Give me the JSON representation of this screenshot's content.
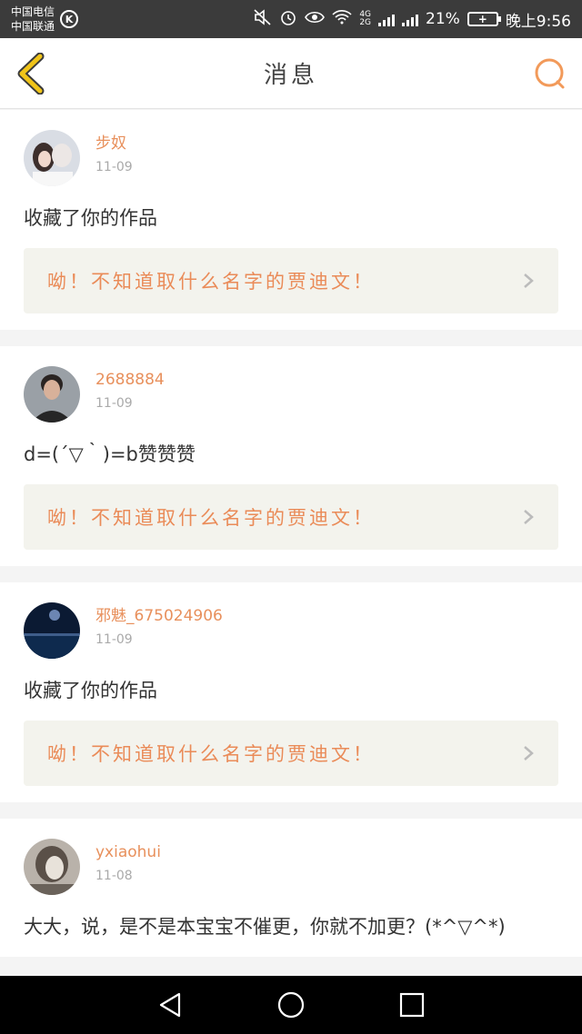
{
  "status": {
    "carrier1": "中国电信",
    "carrier2": "中国联通",
    "badge": "K",
    "net1": "4G",
    "net2": "2G",
    "battery_pct": "21%",
    "time": "晚上9:56"
  },
  "header": {
    "title": "消息"
  },
  "messages": [
    {
      "username": "步奴",
      "date": "11-09",
      "text": "收藏了你的作品",
      "work": "呦！不知道取什么名字的贾迪文！"
    },
    {
      "username": "2688884",
      "date": "11-09",
      "text": "d=(´▽｀)=b赞赞赞",
      "work": "呦！不知道取什么名字的贾迪文！"
    },
    {
      "username": "邪魅_675024906",
      "date": "11-09",
      "text": "收藏了你的作品",
      "work": "呦！不知道取什么名字的贾迪文！"
    },
    {
      "username": "yxiaohui",
      "date": "11-08",
      "text": "大大，说，是不是本宝宝不催更，你就不加更？(*^▽^*)",
      "work": ""
    }
  ],
  "colors": {
    "accent": "#e8905c",
    "link_bg": "#f3f3ed",
    "back_icon": "#f0c419"
  },
  "icons": [
    "back-icon",
    "search-icon",
    "chevron-right-icon",
    "nav-back-icon",
    "nav-home-icon",
    "nav-recents-icon"
  ]
}
